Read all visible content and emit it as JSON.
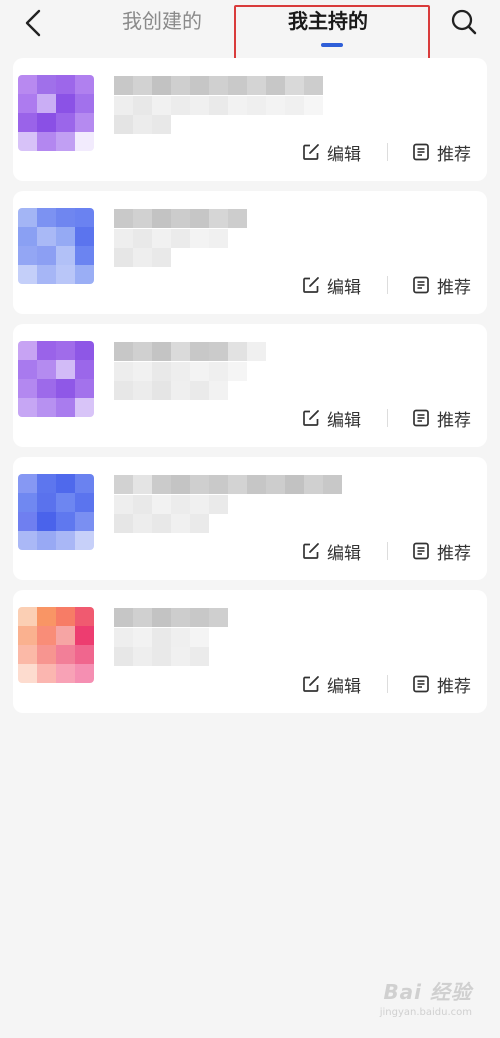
{
  "header": {
    "tabs": [
      {
        "label": "我创建的",
        "active": false
      },
      {
        "label": "我主持的",
        "active": true
      }
    ],
    "back_icon": "chevron-left-icon",
    "search_icon": "search-icon",
    "accent_color": "#2f5fd8",
    "highlight_color": "#d93b3b"
  },
  "cards": [
    {
      "thumb_palette": "purple",
      "edit_label": "编辑",
      "recommend_label": "推荐"
    },
    {
      "thumb_palette": "blue",
      "edit_label": "编辑",
      "recommend_label": "推荐"
    },
    {
      "thumb_palette": "purple",
      "edit_label": "编辑",
      "recommend_label": "推荐"
    },
    {
      "thumb_palette": "blue",
      "edit_label": "编辑",
      "recommend_label": "推荐"
    },
    {
      "thumb_palette": "pink",
      "edit_label": "编辑",
      "recommend_label": "推荐"
    }
  ],
  "watermark": {
    "main": "Bai 经验",
    "sub": "jingyan.baidu.com"
  }
}
